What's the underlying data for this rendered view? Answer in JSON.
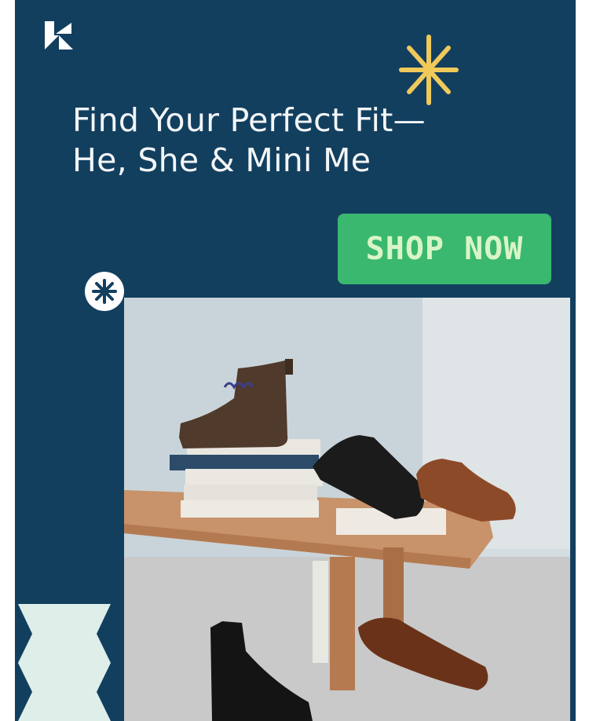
{
  "brand": {
    "logo_icon": "brand-logo-icon"
  },
  "hero": {
    "headline_line1": "Find Your Perfect Fit—",
    "headline_line2": "He, She & Mini Me",
    "cta_label": "SHOP NOW"
  },
  "decor": {
    "yellow_burst_icon": "asterisk-burst-icon",
    "badge_icon": "asterisk-badge-icon",
    "zigzag_icon": "zigzag-shape"
  },
  "product_image": {
    "subject": "shoe-display-photo"
  },
  "colors": {
    "background": "#133f5f",
    "cta": "#3ab86f",
    "cta_text": "#d9f5c6",
    "accent_yellow": "#efc95a",
    "shape_mint": "#deeee9"
  }
}
